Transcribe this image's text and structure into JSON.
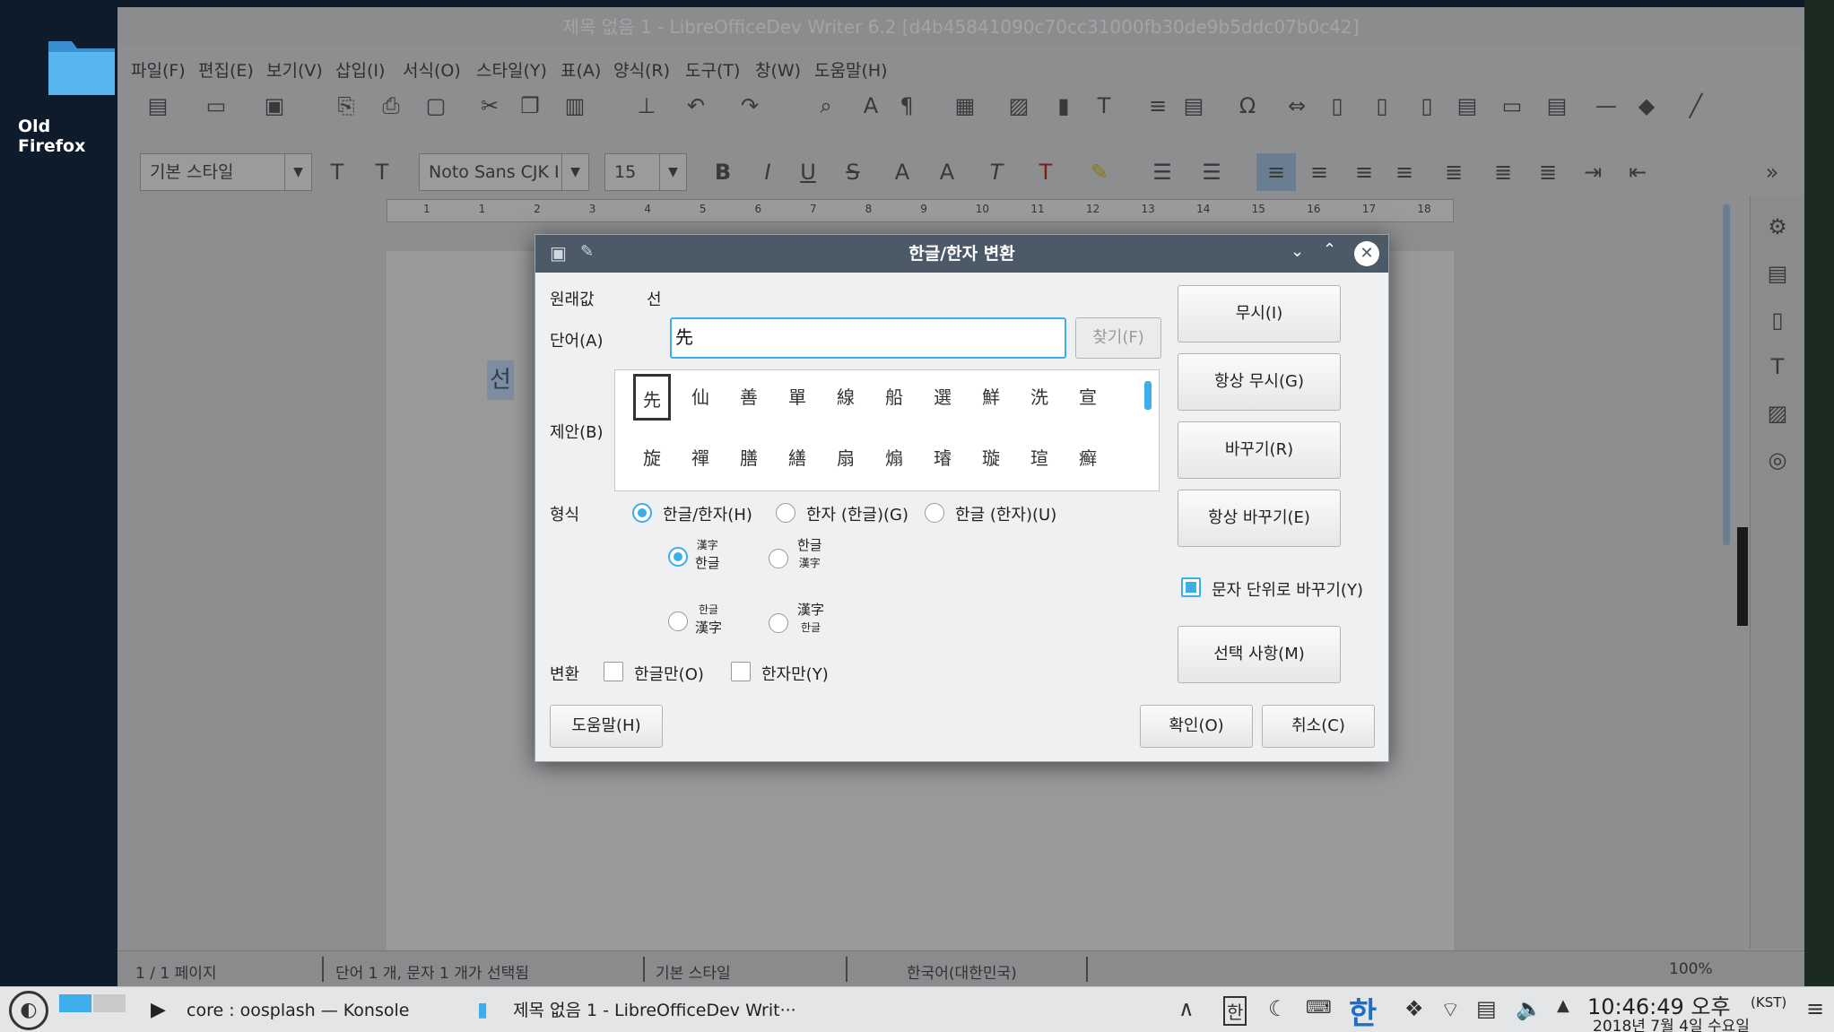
{
  "desktop": {
    "icon_label": "Old Firefox"
  },
  "writer": {
    "title": "제목 없음 1 - LibreOfficeDev Writer 6.2 [d4b45841090c70cc31000fb30de9b5ddc07b0c42]",
    "menu": [
      "파일(F)",
      "편집(E)",
      "보기(V)",
      "삽입(I)",
      "서식(O)",
      "스타일(Y)",
      "표(A)",
      "양식(R)",
      "도구(T)",
      "창(W)",
      "도움말(H)"
    ],
    "paragraph_style": "기본 스타일",
    "font_name": "Noto Sans CJK I",
    "font_size": "15",
    "document_text": "선",
    "ruler_marks": [
      "1",
      "1",
      "2",
      "3",
      "4",
      "5",
      "6",
      "7",
      "8",
      "9",
      "10",
      "11",
      "12",
      "13",
      "14",
      "15",
      "16",
      "17",
      "18"
    ],
    "status": {
      "page": "1 / 1 페이지",
      "words": "단어 1 개, 문자 1 개가 선택됨",
      "style": "기본 스타일",
      "language": "한국어(대한민국)",
      "zoom": "100%"
    }
  },
  "dialog": {
    "title": "한글/한자 변환",
    "original_label": "원래값",
    "original_value": "선",
    "word_label": "단어(A)",
    "word_value": "先",
    "find_button": "찾기(F)",
    "suggestions_label": "제안(B)",
    "suggestions_row1": [
      "先",
      "仙",
      "善",
      "單",
      "線",
      "船",
      "選",
      "鮮",
      "洗",
      "宣"
    ],
    "suggestions_row2": [
      "旋",
      "禪",
      "膳",
      "繕",
      "扇",
      "煽",
      "璿",
      "璇",
      "瑄",
      "癬"
    ],
    "format_label": "형식",
    "format_options": [
      "한글/한자(H)",
      "한자 (한글)(G)",
      "한글 (한자)(U)"
    ],
    "ruby_hanja": "漢字",
    "ruby_hangul": "한글",
    "conversion_label": "변환",
    "hangul_only": "한글만(O)",
    "hanja_only": "한자만(Y)",
    "buttons": {
      "ignore": "무시(I)",
      "always_ignore": "항상 무시(G)",
      "replace": "바꾸기(R)",
      "always_replace": "항상 바꾸기(E)",
      "replace_by_char": "문자 단위로 바꾸기(Y)",
      "options": "선택 사항(M)",
      "help": "도움말(H)",
      "ok": "확인(O)",
      "cancel": "취소(C)"
    }
  },
  "taskbar": {
    "konsole": "core : oosplash — Konsole",
    "writer_task": "제목 없음 1 - LibreOfficeDev Writ···",
    "ime": "한",
    "ime_box": "한",
    "time": "10:46:49 오후",
    "timezone": "(KST)",
    "date": "2018년 7월 4일 수요일"
  },
  "colors": {
    "accent": "#3daee9",
    "dialog_title": "#4c5a68",
    "dim": "#8d8e90"
  }
}
